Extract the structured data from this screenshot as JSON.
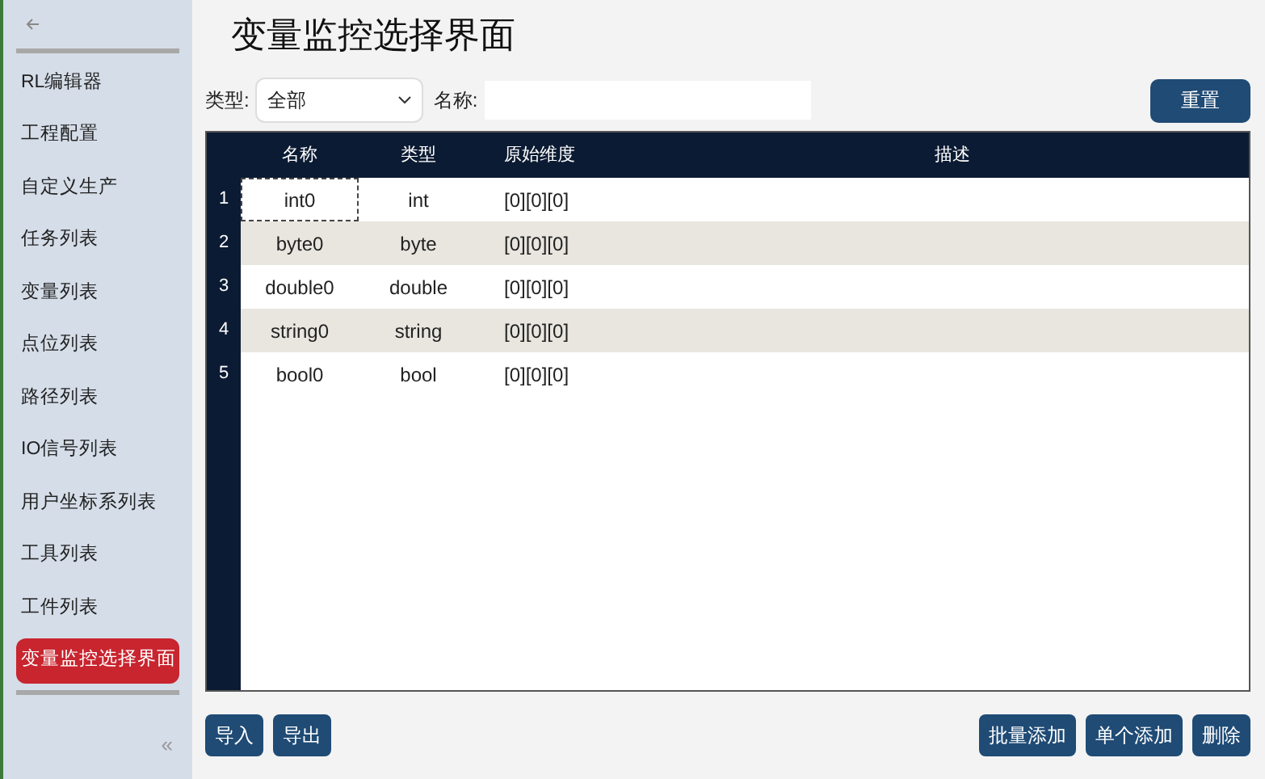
{
  "sidebar": {
    "items": [
      {
        "label": "RL编辑器",
        "selected": false
      },
      {
        "label": "工程配置",
        "selected": false
      },
      {
        "label": "自定义生产",
        "selected": false
      },
      {
        "label": "任务列表",
        "selected": false
      },
      {
        "label": "变量列表",
        "selected": false
      },
      {
        "label": "点位列表",
        "selected": false
      },
      {
        "label": "路径列表",
        "selected": false
      },
      {
        "label": "IO信号列表",
        "selected": false
      },
      {
        "label": "用户坐标系列表",
        "selected": false
      },
      {
        "label": "工具列表",
        "selected": false
      },
      {
        "label": "工件列表",
        "selected": false
      },
      {
        "label": "变量监控选择界面",
        "selected": true
      }
    ],
    "collapse": "«"
  },
  "title": "变量监控选择界面",
  "filters": {
    "type_label": "类型:",
    "type_value": "全部",
    "name_label": "名称:",
    "reset": "重置"
  },
  "table": {
    "columns": [
      "名称",
      "类型",
      "原始维度",
      "描述"
    ],
    "rows": [
      {
        "index": "1",
        "name": "int0",
        "type": "int",
        "dims": "[0][0][0]",
        "selected": true
      },
      {
        "index": "2",
        "name": "byte0",
        "type": "byte",
        "dims": "[0][0][0]",
        "selected": false
      },
      {
        "index": "3",
        "name": "double0",
        "type": "double",
        "dims": "[0][0][0]",
        "selected": false
      },
      {
        "index": "4",
        "name": "string0",
        "type": "string",
        "dims": "[0][0][0]",
        "selected": false
      },
      {
        "index": "5",
        "name": "bool0",
        "type": "bool",
        "dims": "[0][0][0]",
        "selected": false
      }
    ]
  },
  "left_buttons": [
    "导入",
    "导出"
  ],
  "right_buttons": [
    "批量添加",
    "单个添加",
    "删除"
  ]
}
